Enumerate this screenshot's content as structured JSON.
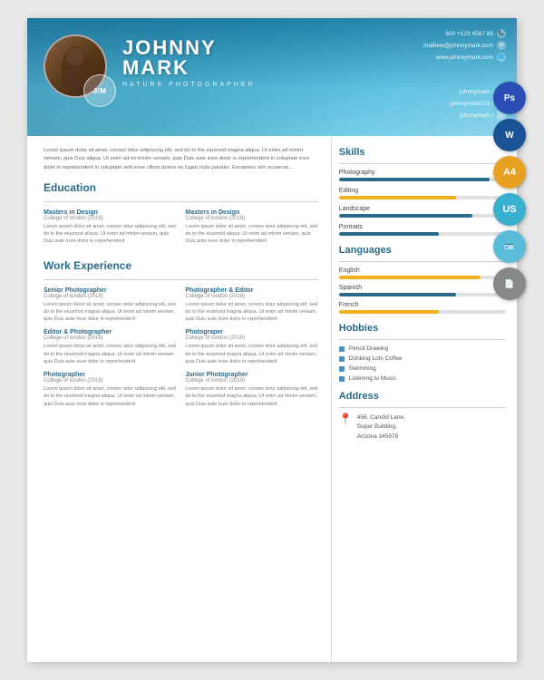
{
  "header": {
    "first_name": "JOHNNY",
    "last_name": "MARK",
    "subtitle": "NATURE PHOTOGRAPHER",
    "monogram": "J/M",
    "phone": "800 +123 4567 89",
    "email": "mathew@johnnymark.com",
    "website": "www.johnnymark.com",
    "social1": "johnnymark /",
    "social2": "johnnymark123 /",
    "social3": "johnnymark /"
  },
  "intro": "Lorem ipsum dolor sit amet, consec tetur adipiscing elit, sed do to the eiusmod magna aliqua. Ut enim ad minim veniam, quis Duis aliqua. Ut enim ad mi minim veniam, quis Duis aute irure dolor in reprehenderit in voluptate irure dolor in reprehenderit in voluptate velit esse cillum dolore eu fugiat nulla pariatur. Excepteur sint occaecat...",
  "education": {
    "title": "Education",
    "items": [
      {
        "title": "Masters in Design",
        "college": "College of london (2018)",
        "body": "Lorem ipsum dolor sit amet, consec tetur adipiscing elit, sed do to the eiusmod aliqua. Ut enim ad minim veniam, quis Duis aute irure dolor in reprehenderit"
      },
      {
        "title": "Masters in Design",
        "college": "College of london (2018)",
        "body": "Lorem ipsum dolor sit amet, consec tetur adipiscing elit, sed do to the eiusmod aliqua. Ut enim ad minim veniam, quis Duis aute irure dolor in reprehenderit"
      }
    ]
  },
  "work": {
    "title": "Work Experience",
    "items": [
      {
        "title": "Senior Photographer",
        "college": "College of london (2018)",
        "body": "Lorem ipsum dolor sit amet, consec tetur adipiscing elit, sed do to the eiusmod magna aliqua. Ut enim ad minim veniam, quis Duis aute irure dolor in reprehenderit"
      },
      {
        "title": "Photographer & Editor",
        "college": "College of london (2018)",
        "body": "Lorem ipsum dolor sit amet, consec tetur adipiscing elit, sed do to the eiusmod magna aliqua. Ut enim ad minim veniam, quis Duis aute irure dolor in reprehenderit"
      },
      {
        "title": "Editor & Photographer",
        "college": "College of london (2018)",
        "body": "Lorem ipsum dolor sit amet, consec tetur adipiscing elit, sed do to the eiusmod magna aliqua. Ut enim ad minim veniam, quis Duis aute irure dolor in reprehenderit"
      },
      {
        "title": "Photograper",
        "college": "College of london (2018)",
        "body": "Lorem ipsum dolor sit amet, consec tetur adipiscing elit, sed do to the eiusmod magna aliqua. Ut enim ad minim veniam, quis Duis aute irure dolor in reprehenderit"
      },
      {
        "title": "Photographer",
        "college": "College of london (2018)",
        "body": "Lorem ipsum dolor sit amet, consec tetur adipiscing elit, sed do to the eiusmod magna aliqua. Ut enim ad minim veniam, quis Duis aute irure dolor in reprehenderit"
      },
      {
        "title": "Junior Photographer",
        "college": "College of london (2018)",
        "body": "Lorem ipsum dolor sit amet, consec tetur adipiscing elit, sed do to the eiusmod magna aliqua. Ut enim ad minim veniam, quis Duis aute irure dolor in reprehenderit"
      }
    ]
  },
  "skills": {
    "title": "Skills",
    "items": [
      {
        "name": "Photography",
        "pct": 90,
        "color": "#2a6b8a"
      },
      {
        "name": "Editing",
        "pct": 70,
        "color": "#f0b020"
      },
      {
        "name": "Landscape",
        "pct": 80,
        "color": "#2a6b8a"
      },
      {
        "name": "Portraits",
        "pct": 60,
        "color": "#2a6b8a"
      }
    ]
  },
  "languages": {
    "title": "Languages",
    "items": [
      {
        "name": "English",
        "pct": 85,
        "color": "#f0b020"
      },
      {
        "name": "Spanish",
        "pct": 70,
        "color": "#2a6b8a"
      },
      {
        "name": "French",
        "pct": 60,
        "color": "#f0b020"
      }
    ]
  },
  "hobbies": {
    "title": "Hobbies",
    "items": [
      {
        "label": "Pencil Drawing",
        "color": "#4a90c4"
      },
      {
        "label": "Drinking Lots Coffee",
        "color": "#4a90c4"
      },
      {
        "label": "Swimming",
        "color": "#4a90c4"
      },
      {
        "label": "Listening to Music",
        "color": "#4a90c4"
      }
    ]
  },
  "address": {
    "title": "Address",
    "line1": "456, Candid Lane,",
    "line2": "Super Building,",
    "line3": "Arizona  345678"
  }
}
